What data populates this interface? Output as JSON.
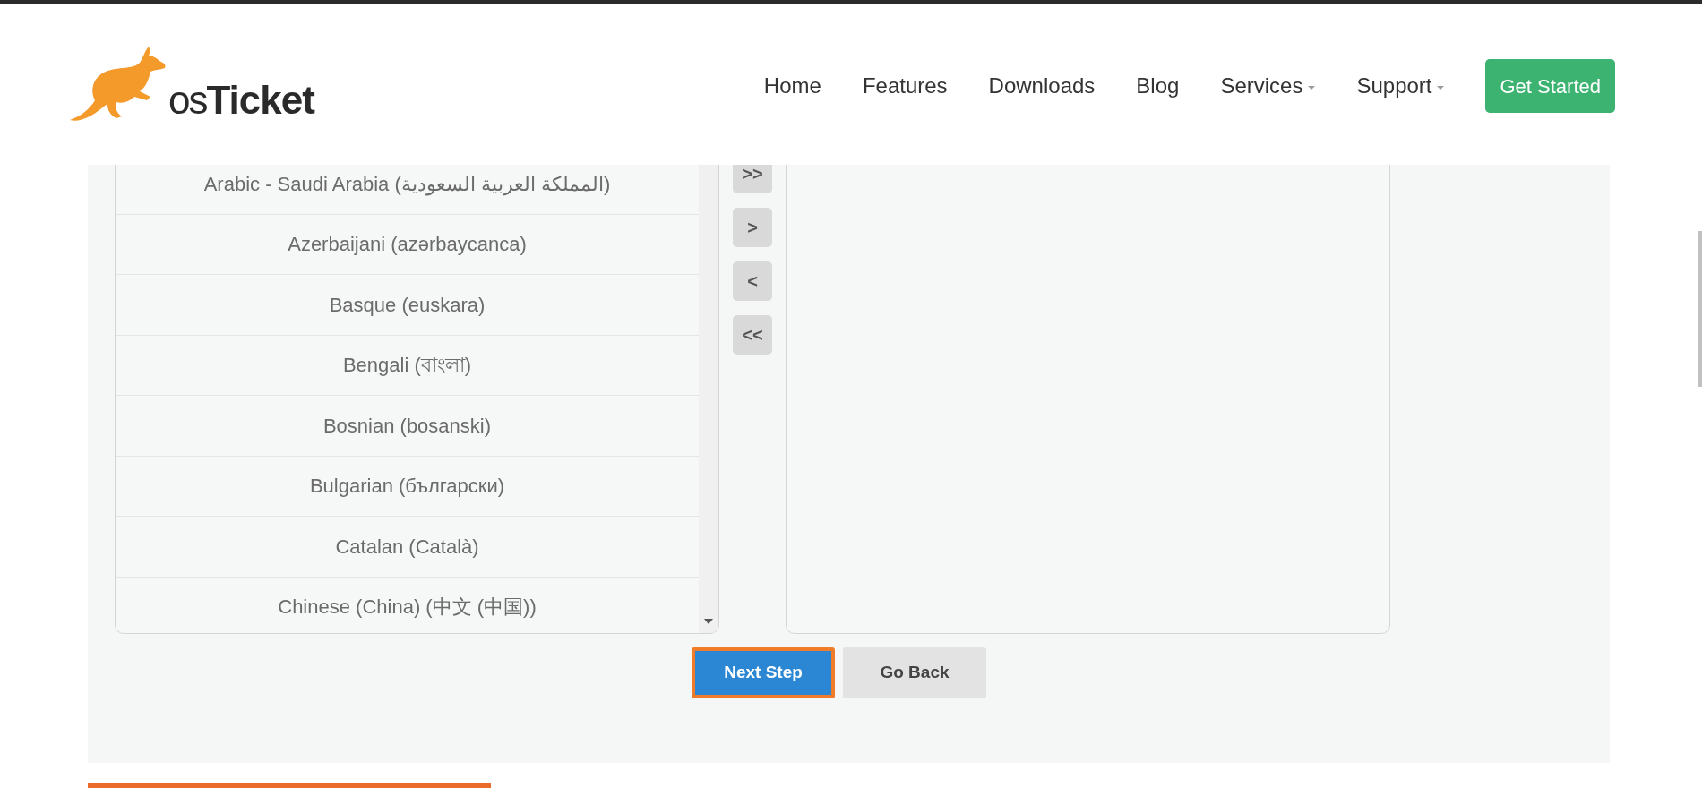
{
  "header": {
    "logo": {
      "part_1": "os",
      "part_2": "Ticket"
    },
    "nav": [
      {
        "label": "Home",
        "dropdown": false
      },
      {
        "label": "Features",
        "dropdown": false
      },
      {
        "label": "Downloads",
        "dropdown": false
      },
      {
        "label": "Blog",
        "dropdown": false
      },
      {
        "label": "Services",
        "dropdown": true
      },
      {
        "label": "Support",
        "dropdown": true
      }
    ],
    "cta": "Get Started"
  },
  "available_languages": [
    "Arabic - Saudi Arabia (المملكة العربية السعودية)",
    "Azerbaijani (azərbaycanca)",
    "Basque (euskara)",
    "Bengali (বাংলা)",
    "Bosnian (bosanski)",
    "Bulgarian (български)",
    "Catalan (Català)",
    "Chinese (China) (中文 (中国))"
  ],
  "move_buttons": [
    ">>",
    ">",
    "<",
    "<<"
  ],
  "actions": [
    {
      "label": "Next Step",
      "kind": "primary",
      "focused": true
    },
    {
      "label": "Go Back",
      "kind": "secondary",
      "focused": false
    }
  ]
}
